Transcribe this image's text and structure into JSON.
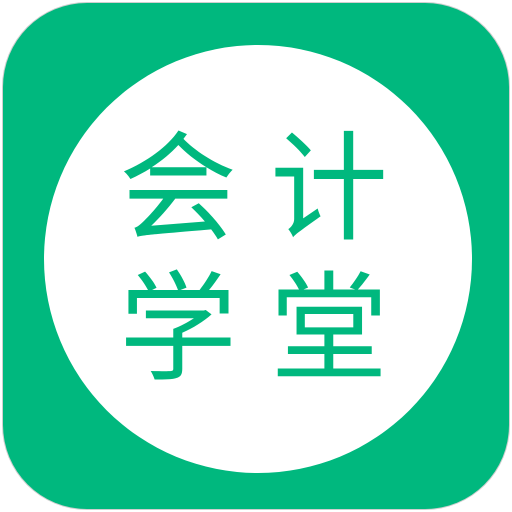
{
  "logo": {
    "characters": [
      "会",
      "计",
      "学",
      "堂"
    ],
    "colors": {
      "brand": "#00b87e",
      "circle": "#ffffff",
      "border": "#cfcfcf"
    }
  }
}
